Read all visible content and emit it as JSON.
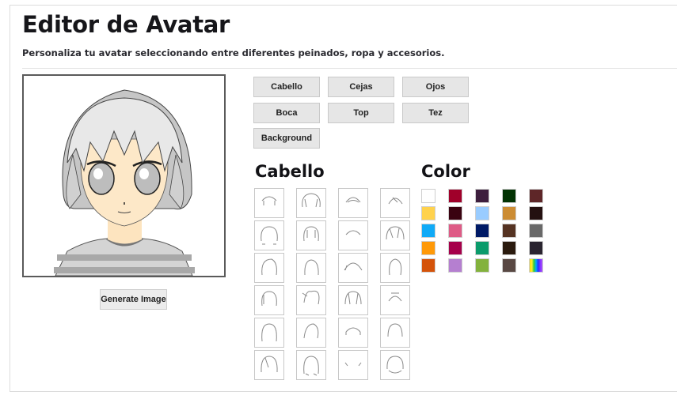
{
  "header": {
    "title": "Editor de Avatar",
    "subtitle": "Personaliza tu avatar seleccionando entre diferentes peinados, ropa y accesorios."
  },
  "preview": {
    "icon": "avatar-preview-image",
    "generate_label": "Generate Image"
  },
  "categories": [
    {
      "label": "Cabello"
    },
    {
      "label": "Cejas"
    },
    {
      "label": "Ojos"
    },
    {
      "label": "Boca"
    },
    {
      "label": "Top"
    },
    {
      "label": "Tez"
    },
    {
      "label": "Background"
    }
  ],
  "hair_section": {
    "title": "Cabello",
    "option_count": 24,
    "icon": "hairstyle-thumbnail-icon"
  },
  "color_section": {
    "title": "Color",
    "swatches": [
      "#ffffff",
      "#a0002a",
      "#3e1f3e",
      "#023303",
      "#5e2628",
      "#ffd24d",
      "#3a0210",
      "#99ccff",
      "#cc8c33",
      "#241010",
      "#10aaf7",
      "#de5b86",
      "#001a66",
      "#553322",
      "#696969",
      "#ff9908",
      "#a5004a",
      "#0b9b6b",
      "#2a1a0e",
      "#2a2430",
      "#d4530a",
      "#b57fd0",
      "#83b23d",
      "#594843",
      "rainbow"
    ]
  }
}
